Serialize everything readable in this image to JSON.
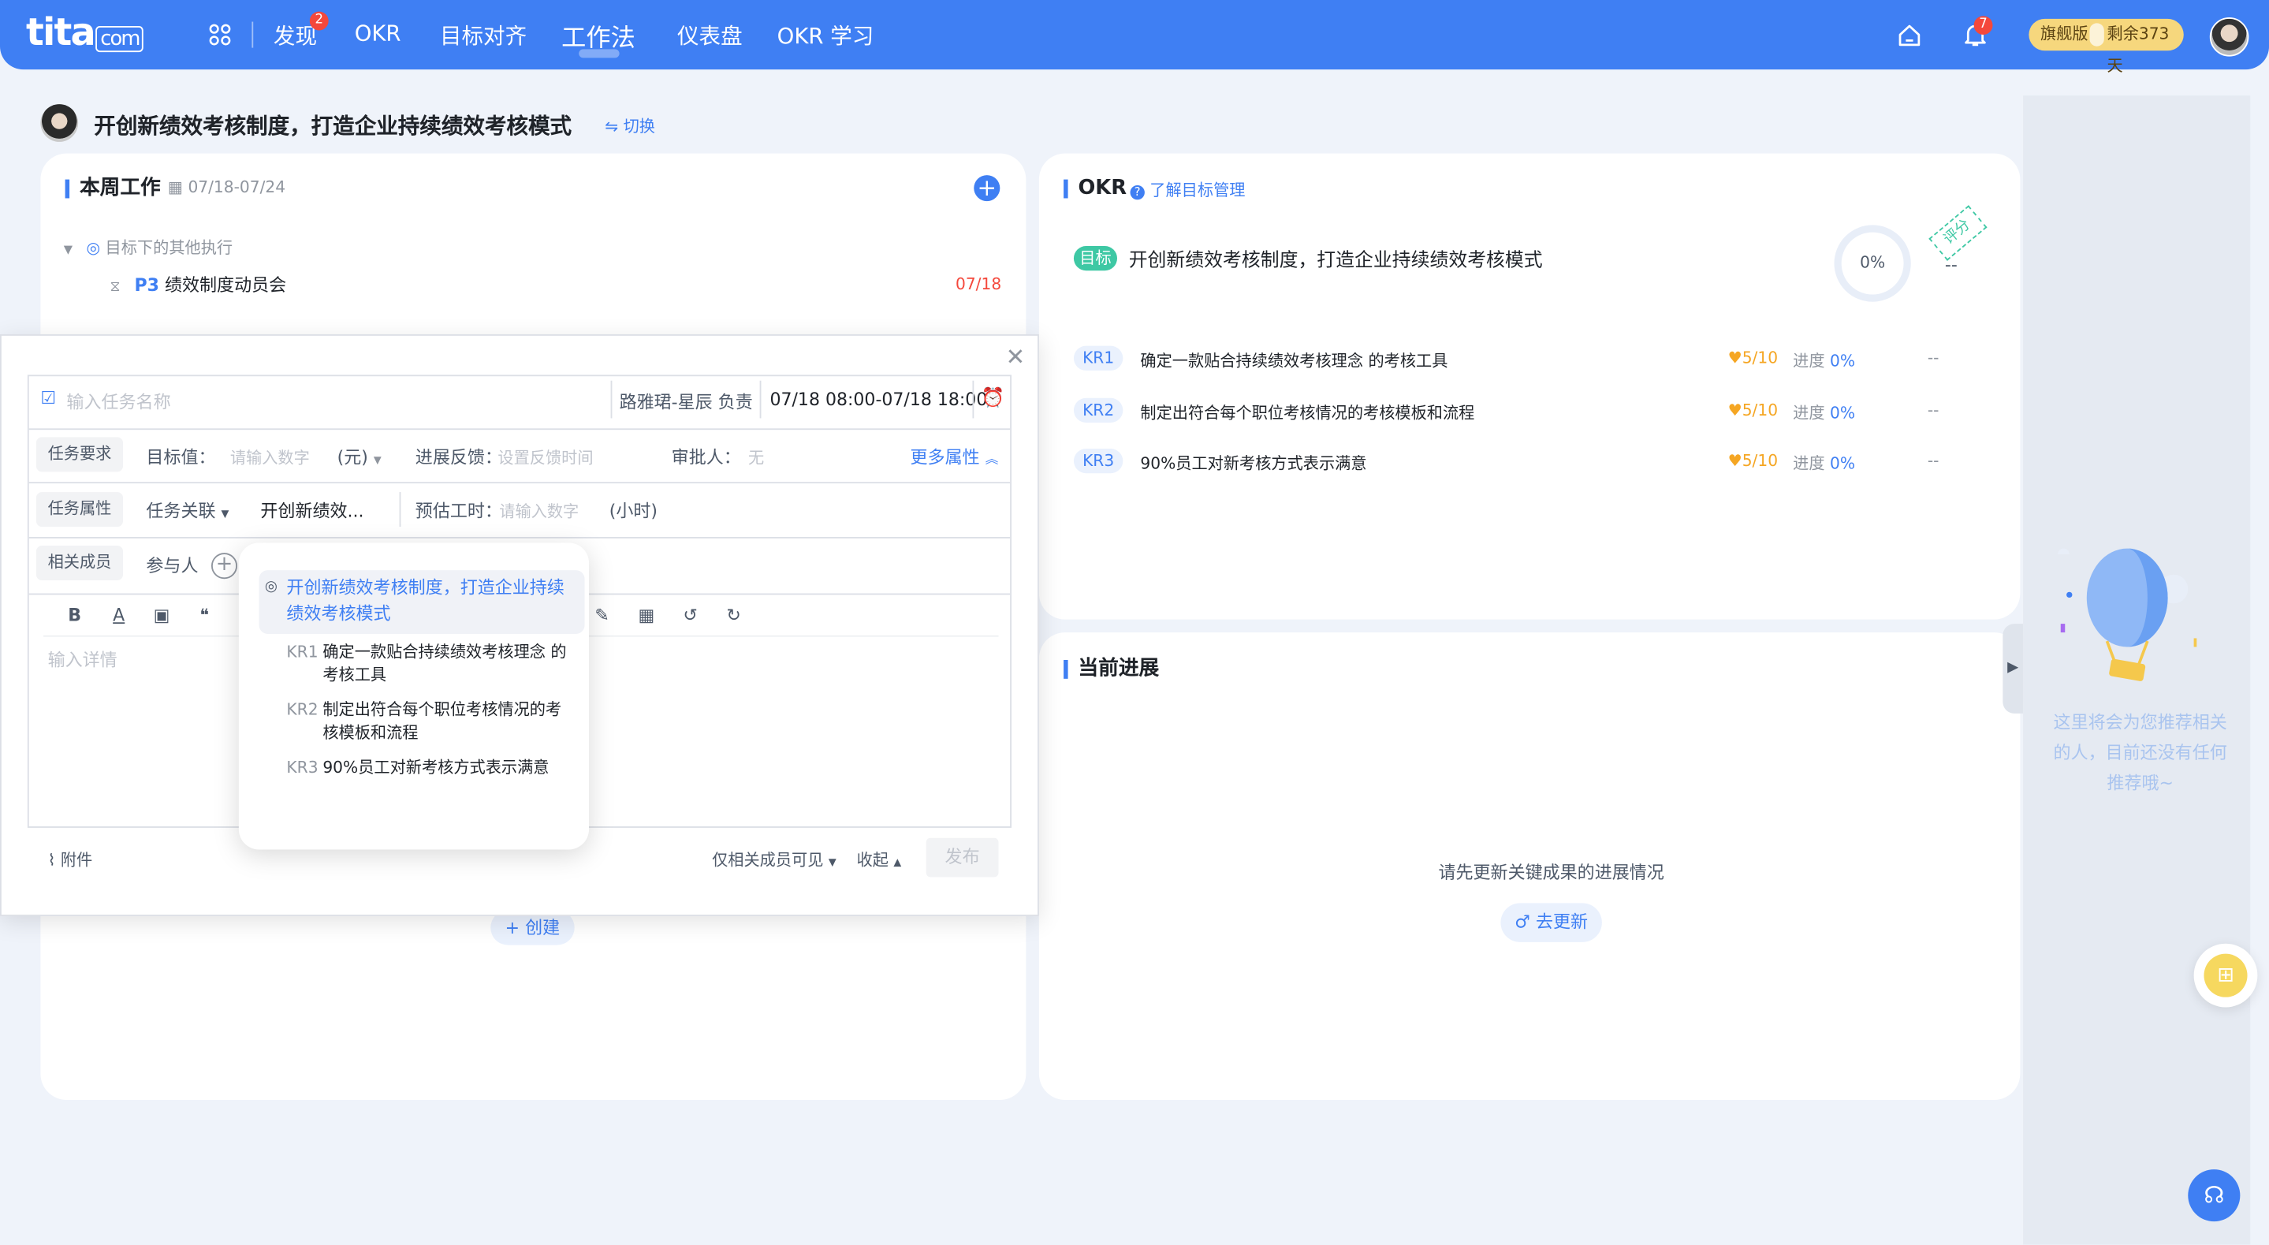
{
  "topbar": {
    "logo": "tita",
    "logo_suffix": "com",
    "nav": [
      {
        "label": "发现",
        "badge": "2"
      },
      {
        "label": "OKR"
      },
      {
        "label": "目标对齐"
      },
      {
        "label": "工作法"
      },
      {
        "label": "仪表盘"
      },
      {
        "label": "OKR 学习"
      }
    ],
    "bell_badge": "7",
    "plan_label": "旗舰版",
    "plan_remaining": "剩余373天"
  },
  "header": {
    "title": "开创新绩效考核制度，打造企业持续绩效考核模式",
    "switch_label": "切换"
  },
  "weekly": {
    "title": "本周工作",
    "date_range": "07/18-07/24",
    "group_label": "目标下的其他执行",
    "task_priority": "P3",
    "task_name": "绩效制度动员会",
    "task_date": "07/18",
    "create_label": "创建"
  },
  "task_form": {
    "name_placeholder": "输入任务名称",
    "owner": "路雅珺-星辰 负责",
    "time_range": "07/18 08:00-07/18 18:00",
    "req_chip": "任务要求",
    "target_label": "目标值：",
    "target_placeholder": "请输入数字",
    "unit": "(元)",
    "feedback_label": "进展反馈：",
    "feedback_placeholder": "设置反馈时间",
    "approver_label": "审批人：",
    "approver_value": "无",
    "more_label": "更多属性",
    "attr_chip": "任务属性",
    "relation_label": "任务关联",
    "relation_value": "开创新绩效...",
    "hours_label": "预估工时：",
    "hours_placeholder": "请输入数字",
    "hours_unit": "(小时)",
    "member_chip": "相关成员",
    "participant_label": "参与人",
    "detail_placeholder": "输入详情",
    "attach_label": "附件",
    "visibility_label": "仅相关成员可见",
    "collapse_label": "收起",
    "publish_label": "发布"
  },
  "dropdown": {
    "objective": "开创新绩效考核制度，打造企业持续绩效考核模式",
    "krs": [
      {
        "tag": "KR1",
        "text": "确定一款贴合持续绩效考核理念 的考核工具"
      },
      {
        "tag": "KR2",
        "text": "制定出符合每个职位考核情况的考核模板和流程"
      },
      {
        "tag": "KR3",
        "text": "90%员工对新考核方式表示满意"
      }
    ]
  },
  "okr": {
    "title": "OKR",
    "learn_label": "了解目标管理",
    "objective_tag": "目标",
    "objective_title": "开创新绩效考核制度，打造企业持续绩效考核模式",
    "progress": "0%",
    "score_stamp": "评分",
    "score": "--",
    "krs": [
      {
        "tag": "KR1",
        "text": "确定一款贴合持续绩效考核理念 的考核工具",
        "confidence": "5/10",
        "progress_label": "进度",
        "progress": "0%",
        "score": "--"
      },
      {
        "tag": "KR2",
        "text": "制定出符合每个职位考核情况的考核模板和流程",
        "confidence": "5/10",
        "progress_label": "进度",
        "progress": "0%",
        "score": "--"
      },
      {
        "tag": "KR3",
        "text": "90%员工对新考核方式表示满意",
        "confidence": "5/10",
        "progress_label": "进度",
        "progress": "0%",
        "score": "--"
      }
    ]
  },
  "current_progress": {
    "title": "当前进展",
    "empty_text": "请先更新关键成果的进展情况",
    "update_label": "去更新"
  },
  "sidebar": {
    "empty_text": "这里将会为您推荐相关的人，目前还没有任何推荐哦~"
  },
  "colors": {
    "primary": "#3f7ff3",
    "objective_green": "#3ec8a4",
    "danger": "#f4483c",
    "confidence": "#f5a623"
  }
}
